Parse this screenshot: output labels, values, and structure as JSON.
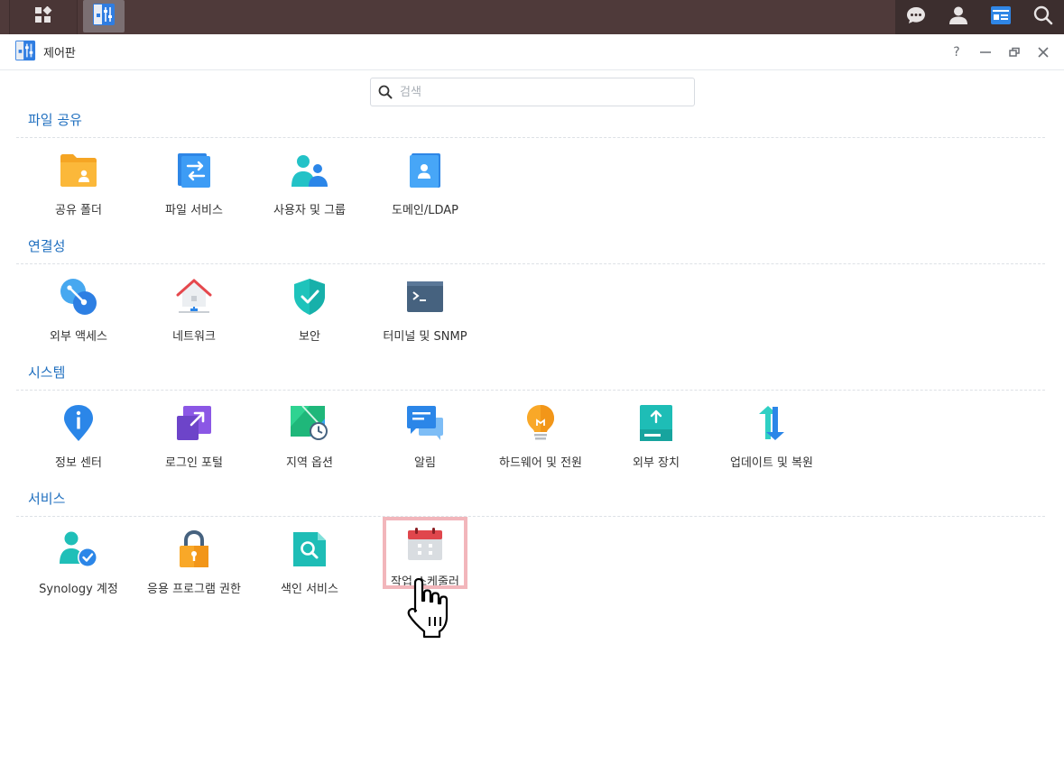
{
  "window": {
    "title": "제어판"
  },
  "taskbar": {
    "left_icons": [
      "grid-icon",
      "control-panel-app-icon"
    ],
    "right_icons": [
      "chat-icon",
      "user-icon",
      "widgets-icon",
      "search-icon"
    ]
  },
  "search": {
    "placeholder": "검색"
  },
  "sections": [
    {
      "title": "파일 공유",
      "items": [
        "공유 폴더",
        "파일 서비스",
        "사용자 및 그룹",
        "도메인/LDAP"
      ]
    },
    {
      "title": "연결성",
      "items": [
        "외부 액세스",
        "네트워크",
        "보안",
        "터미널 및 SNMP"
      ]
    },
    {
      "title": "시스템",
      "items": [
        "정보 센터",
        "로그인 포털",
        "지역 옵션",
        "알림",
        "하드웨어 및 전원",
        "외부 장치",
        "업데이트 및 복원"
      ]
    },
    {
      "title": "서비스",
      "items": [
        "Synology 계정",
        "응용 프로그램 권한",
        "색인 서비스",
        "작업 스케줄러"
      ]
    }
  ],
  "highlighted_item": "작업 스케줄러",
  "colors": {
    "accent": "#1f6fbf",
    "highlight": "#f2b6bb",
    "taskbar": "#4f3a3a"
  }
}
